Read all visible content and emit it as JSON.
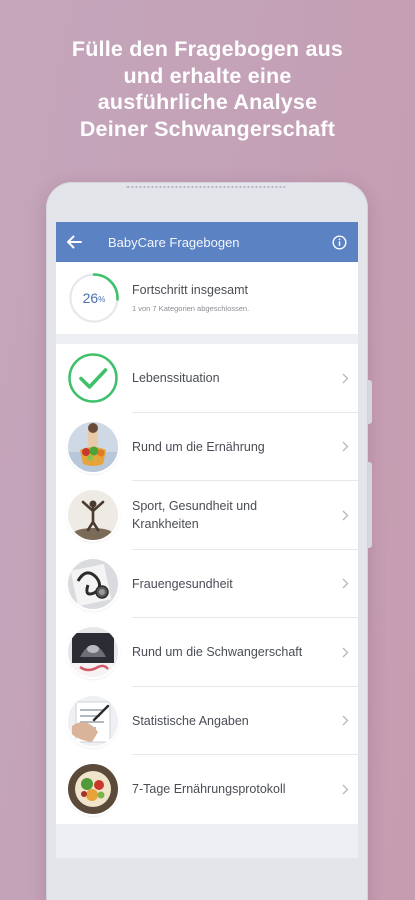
{
  "headline": {
    "line1": "Fülle den Fragebogen aus",
    "line2": "und erhalte eine",
    "line3": "ausführliche Analyse",
    "line4": "Deiner Schwangerschaft"
  },
  "appbar": {
    "title": "BabyCare Fragebogen",
    "back_icon": "arrow-left-icon",
    "info_icon": "info-circle-icon"
  },
  "progress": {
    "value": 26,
    "percent_label": "26",
    "percent_sign": "%",
    "title": "Fortschritt insgesamt",
    "subtitle": "1 von 7 Kategorien abgeschlossen.",
    "ring_color": "#3fc06a",
    "ring_track_color": "#e6e8ec"
  },
  "categories": [
    {
      "label": "Lebenssituation",
      "completed": true,
      "icon": "check-circle-icon"
    },
    {
      "label": "Rund um die Ernährung",
      "completed": false,
      "icon": "nutrition-image"
    },
    {
      "label": "Sport, Gesundheit und Krankheiten",
      "completed": false,
      "icon": "yoga-image"
    },
    {
      "label": "Frauengesundheit",
      "completed": false,
      "icon": "stethoscope-image"
    },
    {
      "label": "Rund um die Schwangerschaft",
      "completed": false,
      "icon": "ultrasound-image"
    },
    {
      "label": "Statistische Angaben",
      "completed": false,
      "icon": "form-writing-image"
    },
    {
      "label": "7-Tage Ernährungsprotokoll",
      "completed": false,
      "icon": "food-bowl-image"
    }
  ],
  "colors": {
    "appbar": "#5b82c2",
    "check_green": "#3fc06a",
    "background_gradient_start": "#c5a6bb",
    "background_gradient_end": "#c69cb0"
  }
}
